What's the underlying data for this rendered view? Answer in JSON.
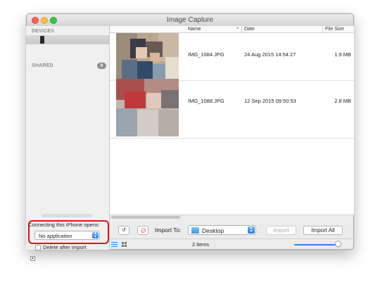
{
  "window": {
    "title": "Image Capture"
  },
  "sidebar": {
    "devices_header": "DEVICES",
    "shared_header": "SHARED",
    "shared_count": "0",
    "connect_label": "Connecting this iPhone opens:",
    "connect_app": "No application",
    "delete_after_import_label": "Delete after import",
    "delete_after_import_checked": false
  },
  "file_list": {
    "columns": {
      "name": "Name",
      "date": "Date",
      "size": "File Size"
    },
    "sort": {
      "column": "Name",
      "indicator": "^"
    },
    "rows": [
      {
        "name": "IMG_1084.JPG",
        "date": "24 Aug 2015 14:54:27",
        "size": "1.9 MB"
      },
      {
        "name": "IMG_1088.JPG",
        "date": "12 Sep 2015 09:50:53",
        "size": "2.8 MB"
      }
    ]
  },
  "toolbar": {
    "import_to_label": "Import To:",
    "destination": "Desktop",
    "import_label": "Import",
    "import_all_label": "Import All",
    "rotate_glyph": "↺"
  },
  "statusbar": {
    "items_count": "2 items",
    "thumbnail_size_fraction": 0.95
  },
  "colors": {
    "accent": "#1f7ce8",
    "highlight_border": "#d8141a"
  },
  "icons": [
    "phone-icon",
    "rotate-icon",
    "delete-icon",
    "folder-icon",
    "list-view-icon",
    "icon-view-icon",
    "chevron-updown-icon"
  ]
}
